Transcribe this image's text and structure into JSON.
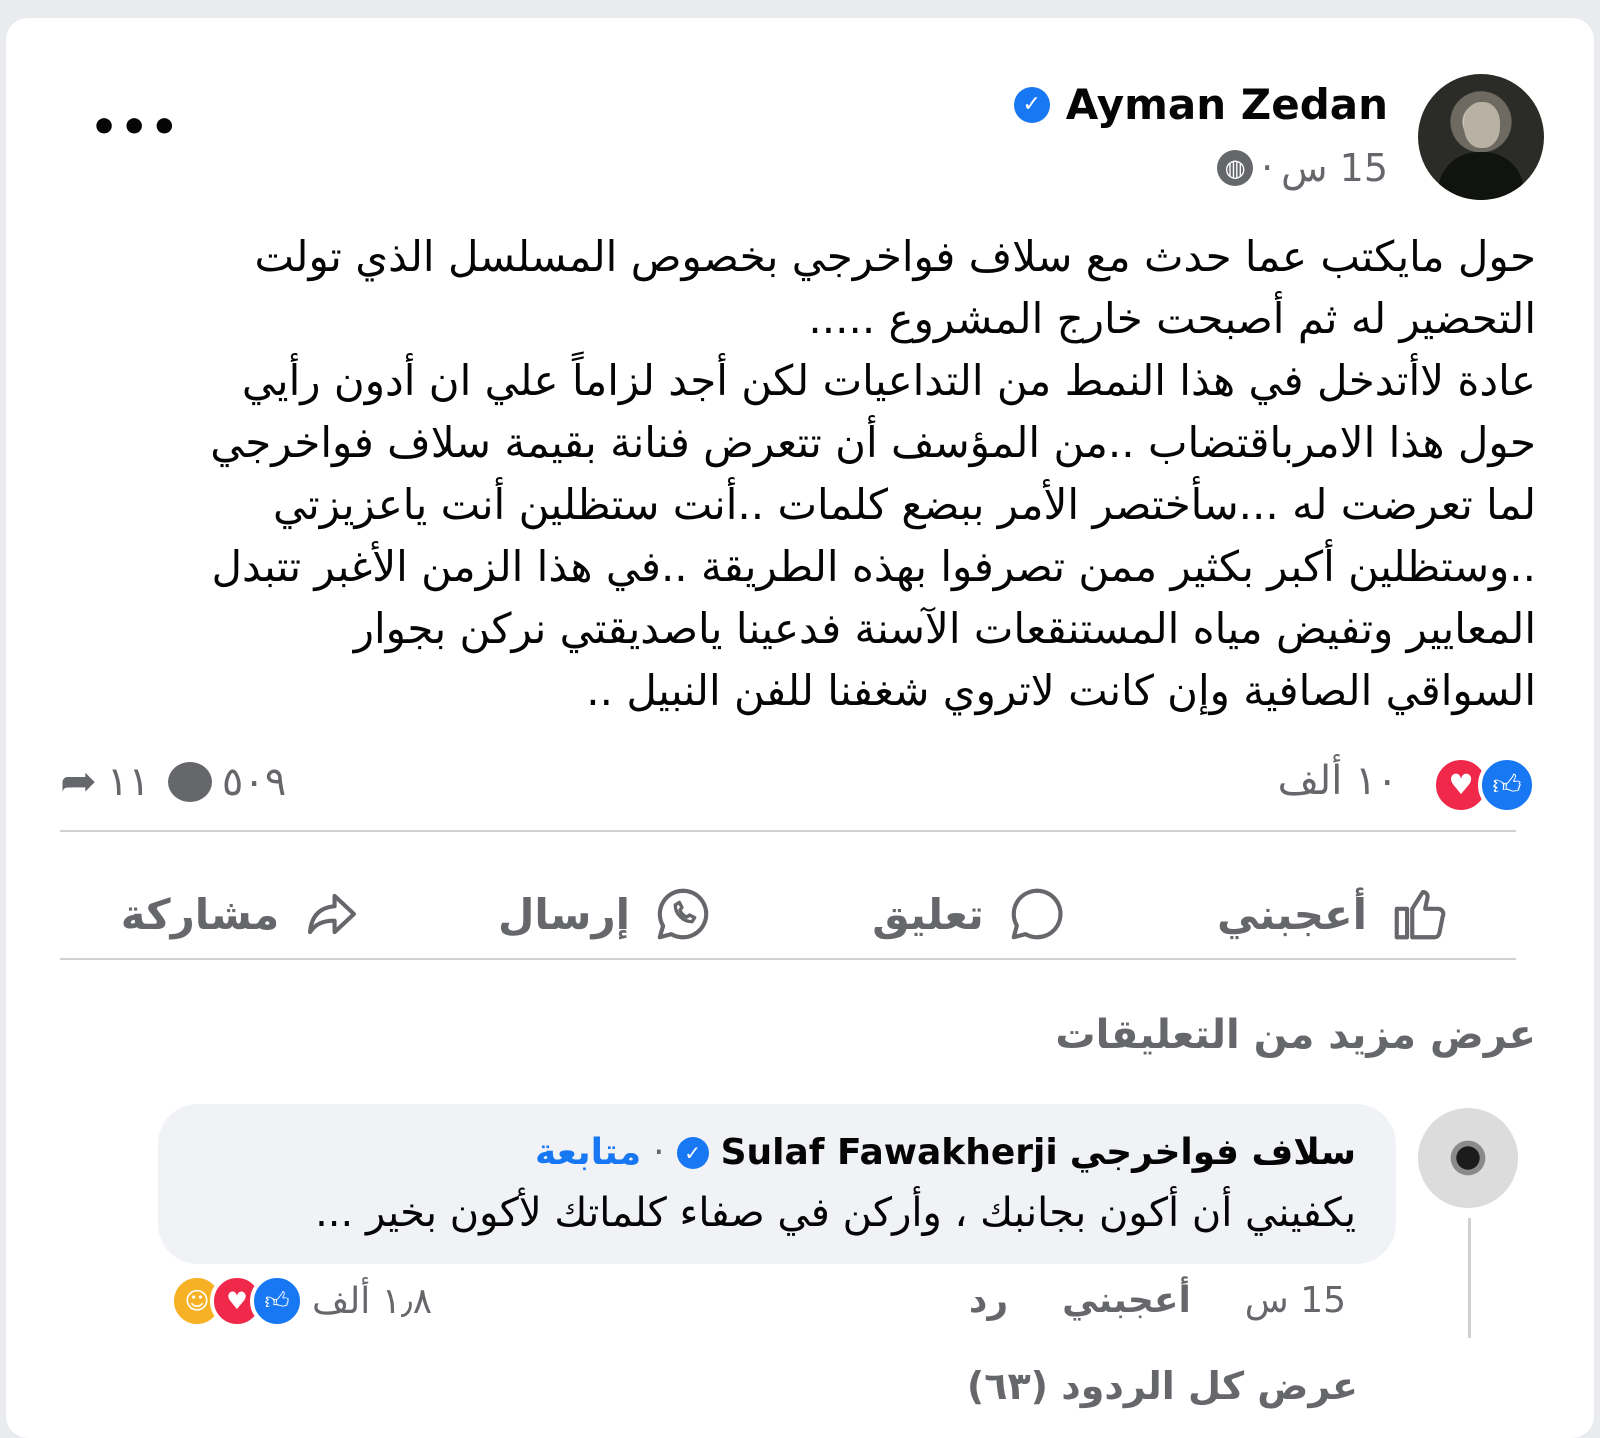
{
  "post": {
    "author": "Ayman Zedan",
    "time": "15 س",
    "meta_sep": "·",
    "privacy_icon": "globe-icon",
    "more_label": "•••",
    "text_lines": [
      "حول مايكتب عما حدث مع سلاف فواخرجي بخصوص المسلسل الذي تولت",
      "التحضير له ثم أصبحت خارج المشروع .....",
      "عادة لاأتدخل في هذا النمط من التداعيات لكن أجد لزاماً علي ان أدون رأيي",
      "حول هذا الامرباقتضاب ..من المؤسف أن تتعرض فنانة بقيمة سلاف فواخرجي",
      "لما تعرضت له ...سأختصر الأمر ببضع كلمات ..أنت ستظلين أنت ياعزيزتي",
      "..وستظلين أكبر بكثير ممن تصرفوا بهذه الطريقة ..في هذا الزمن الأغبر تتبدل",
      "المعايير وتفيض مياه المستنقعات الآسنة فدعينا ياصديقتي نركن بجوار",
      "السواقي الصافية وإن كانت  لاتروي شغفنا للفن النبيل .."
    ],
    "reactions_count": "١٠ ألف",
    "comments_count": "٥٠٩",
    "shares_count": "١١"
  },
  "actions": {
    "like": "أعجبني",
    "comment": "تعليق",
    "send": "إرسال",
    "share": "مشاركة"
  },
  "comments": {
    "view_more": "عرض مزيد من التعليقات",
    "first": {
      "name_ar": "سلاف فواخرجي",
      "name_en": "Sulaf Fawakherji",
      "sep": "·",
      "follow": "متابعة",
      "text": "يكفيني أن أكون بجانبك ، وأركن في صفاء كلماتك لأكون بخير ...",
      "time": "15 س",
      "like": "أعجبني",
      "reply": "رد",
      "reactions_count": "١٫٨ ألف"
    },
    "view_all_replies": "عرض كل الردود (٦٣)"
  },
  "colors": {
    "accent": "#1877f2",
    "love": "#f0284a",
    "care": "#f7b125",
    "muted": "#65676b"
  }
}
